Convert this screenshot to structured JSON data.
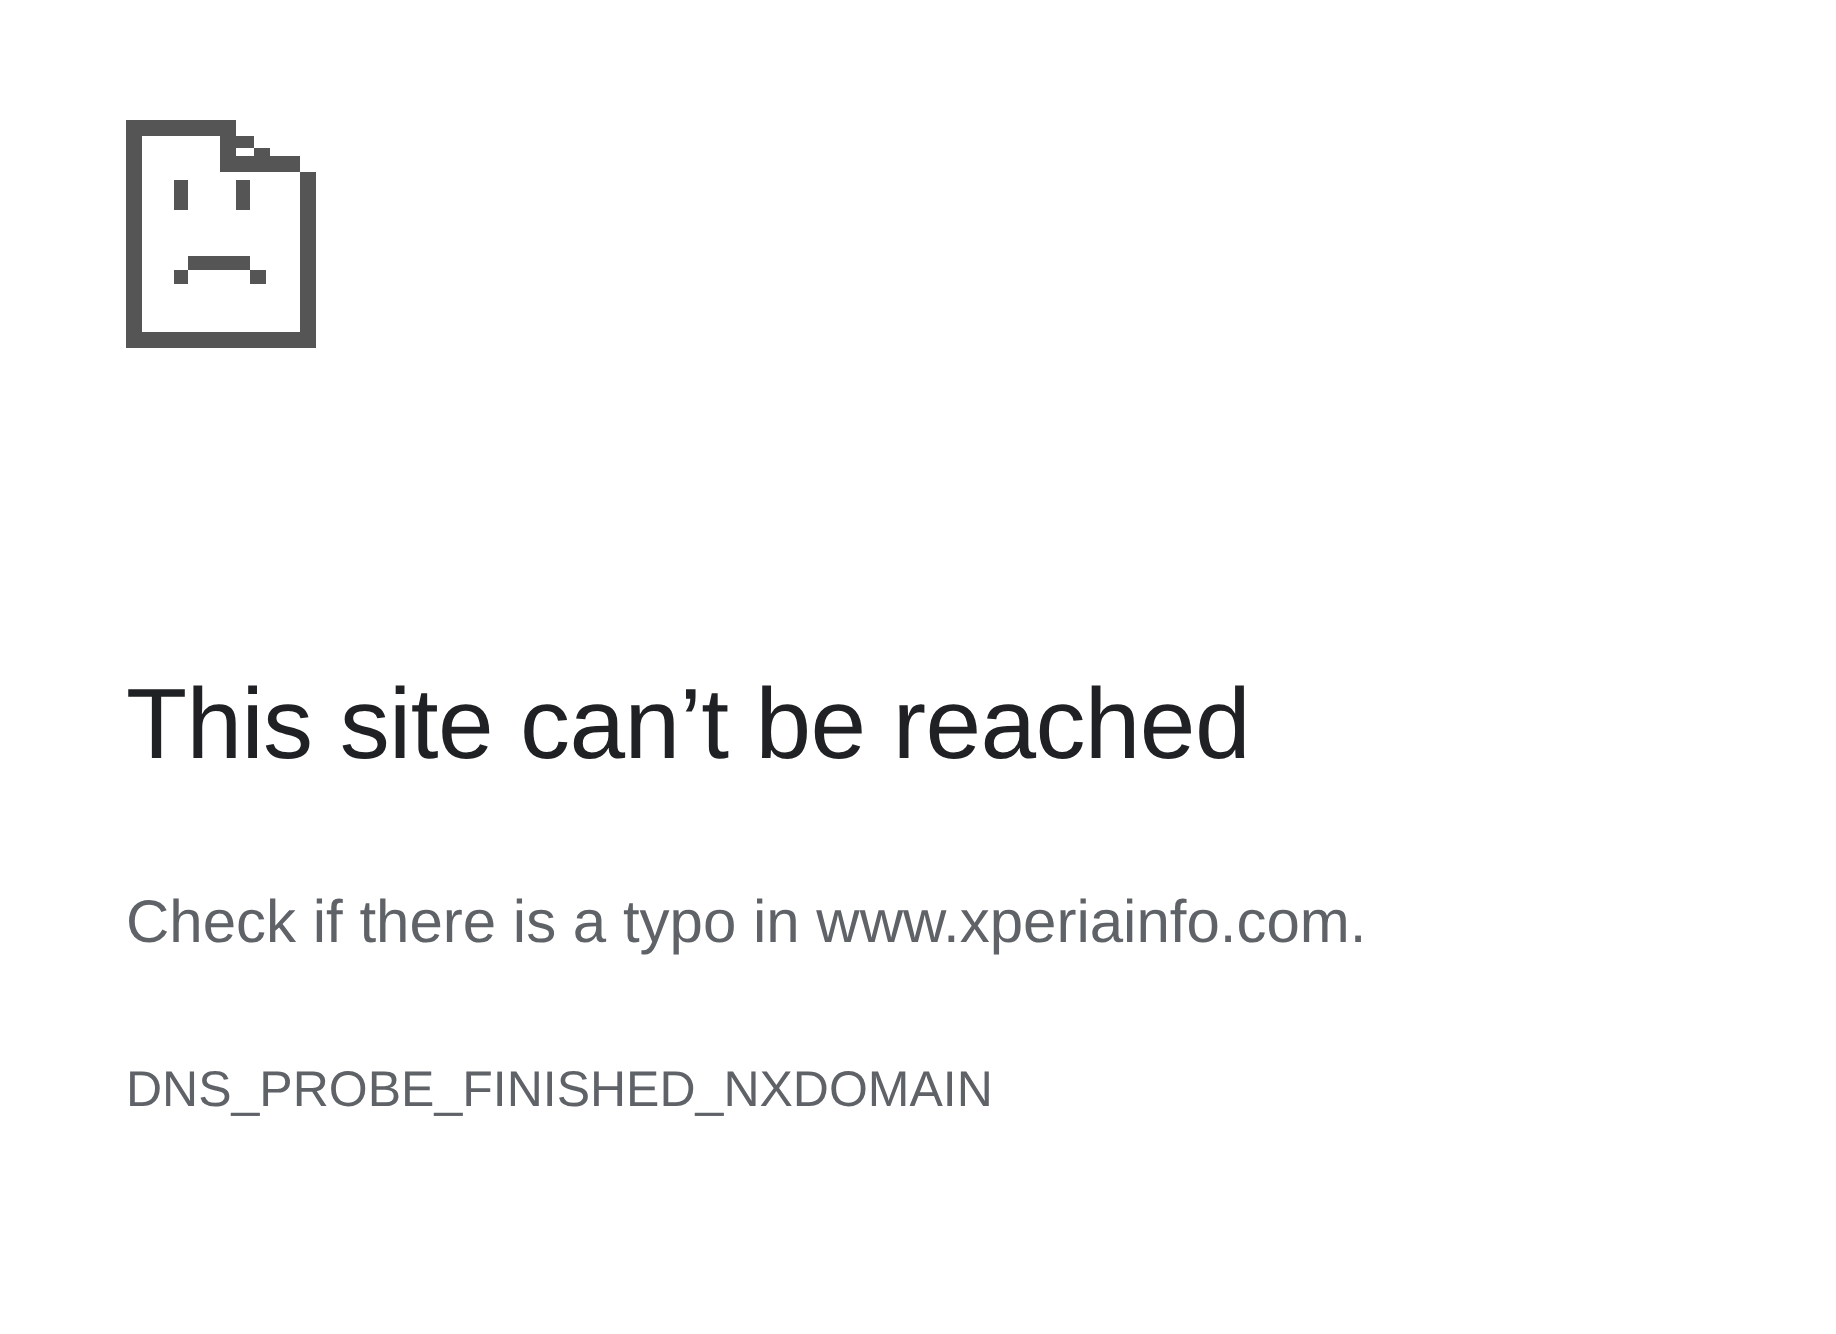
{
  "title": "This site can’t be reached",
  "message": "Check if there is a typo in www.xperiainfo.com.",
  "error_code": "DNS_PROBE_FINISHED_NXDOMAIN"
}
